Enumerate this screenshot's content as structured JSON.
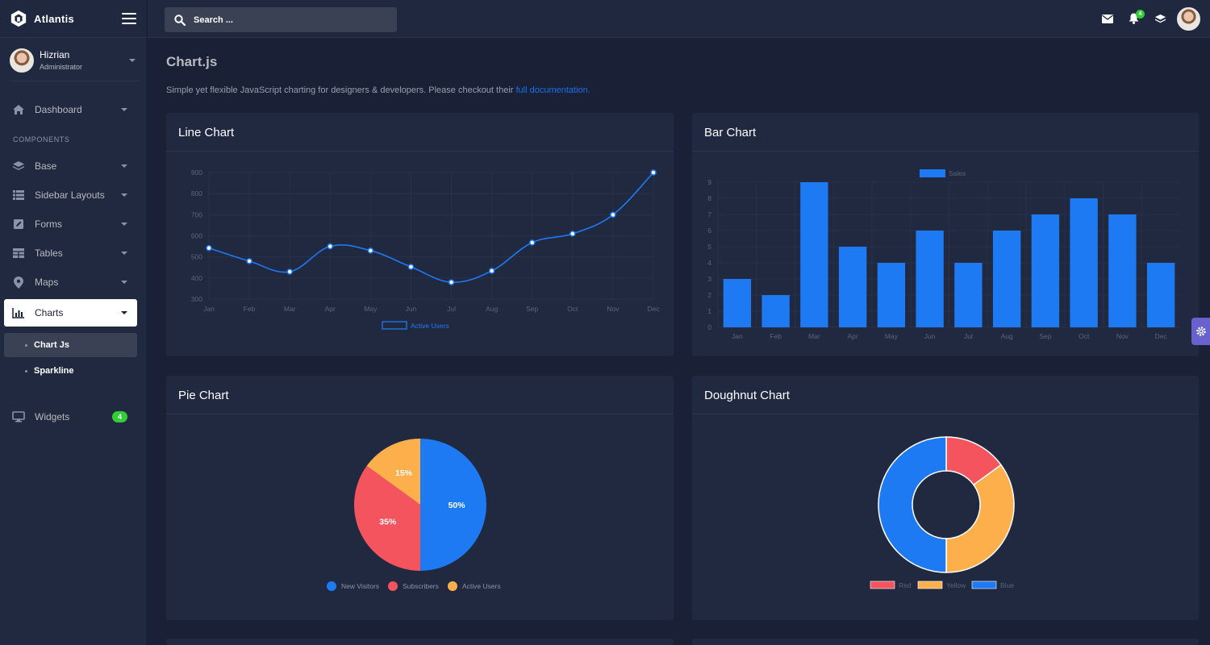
{
  "brand": {
    "name": "Atlantis"
  },
  "user": {
    "name": "Hizrian",
    "role": "Administrator"
  },
  "nav": {
    "dashboard": "Dashboard",
    "section_heading": "COMPONENTS",
    "base": "Base",
    "sidebar_layouts": "Sidebar Layouts",
    "forms": "Forms",
    "tables": "Tables",
    "maps": "Maps",
    "charts": "Charts",
    "chart_js": "Chart Js",
    "sparkline": "Sparkline",
    "widgets": "Widgets",
    "widgets_badge": "4"
  },
  "header": {
    "search_placeholder": "Search ...",
    "notification_count": "4"
  },
  "page": {
    "title": "Chart.js",
    "subtitle": "Simple yet flexible JavaScript charting for designers & developers. Please checkout their ",
    "link_text": "full documentation."
  },
  "colors": {
    "blue": "#1d7af3",
    "red": "#f3545d",
    "yellow": "#fdaf4b",
    "green": "#31ce36",
    "bg": "#1a2035",
    "card": "#202940"
  },
  "cards": {
    "line": {
      "title": "Line Chart"
    },
    "bar": {
      "title": "Bar Chart"
    },
    "pie": {
      "title": "Pie Chart"
    },
    "doughnut": {
      "title": "Doughnut Chart"
    }
  },
  "chart_data": [
    {
      "type": "line",
      "categories": [
        "Jan",
        "Feb",
        "Mar",
        "Apr",
        "May",
        "Jun",
        "Jul",
        "Aug",
        "Sep",
        "Oct",
        "Nov",
        "Dec"
      ],
      "series": [
        {
          "name": "Active Users",
          "values": [
            542,
            480,
            430,
            550,
            530,
            453,
            380,
            434,
            568,
            610,
            700,
            900
          ]
        }
      ],
      "ylim": [
        300,
        900
      ],
      "yticks": [
        300,
        400,
        500,
        600,
        700,
        800,
        900
      ],
      "grid": true,
      "legend": "bottom"
    },
    {
      "type": "bar",
      "categories": [
        "Jan",
        "Feb",
        "Mar",
        "Apr",
        "May",
        "Jun",
        "Jul",
        "Aug",
        "Sep",
        "Oct",
        "Nov",
        "Dec"
      ],
      "series": [
        {
          "name": "Sales",
          "values": [
            3,
            2,
            9,
            5,
            4,
            6,
            4,
            6,
            7,
            8,
            7,
            4
          ]
        }
      ],
      "ylim": [
        0,
        9
      ],
      "yticks": [
        0,
        1,
        2,
        3,
        4,
        5,
        6,
        7,
        8,
        9
      ],
      "grid": true,
      "legend": "top"
    },
    {
      "type": "pie",
      "labels": [
        "New Visitors",
        "Subscribers",
        "Active Users"
      ],
      "values": [
        50,
        35,
        15
      ],
      "value_labels": [
        "50%",
        "35%",
        "15%"
      ],
      "colors": [
        "#1d7af3",
        "#f3545d",
        "#fdaf4b"
      ],
      "legend": "bottom"
    },
    {
      "type": "pie",
      "variant": "doughnut",
      "labels": [
        "Red",
        "Yellow",
        "Blue"
      ],
      "values": [
        15,
        35,
        50
      ],
      "colors": [
        "#f3545d",
        "#fdaf4b",
        "#1d7af3"
      ],
      "legend": "bottom"
    }
  ]
}
